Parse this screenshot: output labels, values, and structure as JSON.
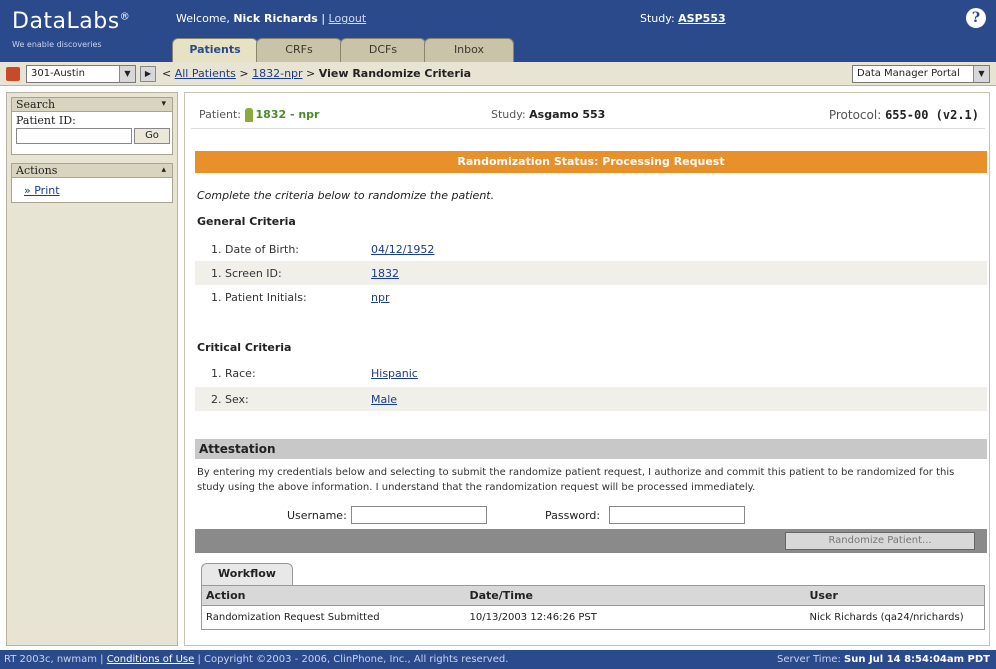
{
  "header": {
    "logo": "DataLabs",
    "logo_mark": "®",
    "tagline": "We enable discoveries",
    "welcome_prefix": "Welcome,",
    "user": "Nick Richards",
    "logout": "Logout",
    "study_label": "Study:",
    "study_value": "ASP553",
    "help": "?"
  },
  "tabs": [
    {
      "label": "Patients"
    },
    {
      "label": "CRFs"
    },
    {
      "label": "DCFs"
    },
    {
      "label": "Inbox"
    }
  ],
  "toolbar": {
    "site": "301-Austin",
    "bc_all": "All Patients",
    "bc_patient": "1832-npr",
    "bc_current": "View Randomize Criteria",
    "portal": "Data Manager Portal"
  },
  "sidebar": {
    "search_title": "Search",
    "patient_id_label": "Patient ID:",
    "go": "Go",
    "actions_title": "Actions",
    "print": "Print"
  },
  "patient_bar": {
    "patient_label": "Patient:",
    "patient_value": "1832 - npr",
    "study_label": "Study:",
    "study_value": "Asgamo 553",
    "protocol_label": "Protocol:",
    "protocol_value": "655-00 (v2.1)"
  },
  "status_banner": "Randomization Status: Processing Request",
  "instruction": "Complete the criteria below to randomize the patient.",
  "general": {
    "title": "General Criteria",
    "rows": [
      {
        "label": "1. Date of Birth:",
        "value": "04/12/1952"
      },
      {
        "label": "1. Screen ID:",
        "value": "1832"
      },
      {
        "label": "1. Patient Initials:",
        "value": "npr"
      }
    ]
  },
  "critical": {
    "title": "Critical Criteria",
    "rows": [
      {
        "label": "1. Race:",
        "value": "Hispanic"
      },
      {
        "label": "2. Sex:",
        "value": "Male"
      }
    ]
  },
  "attestation": {
    "title": "Attestation",
    "text": "By entering my credentials below and selecting to submit the randomize patient request, I authorize and commit this patient to be randomized for this study using the above information. I understand that the randomization request will be processed immediately.",
    "username_label": "Username:",
    "password_label": "Password:",
    "submit": "Randomize Patient..."
  },
  "workflow": {
    "tab": "Workflow",
    "columns": [
      "Action",
      "Date/Time",
      "User"
    ],
    "rows": [
      [
        "Randomization Request Submitted",
        "10/13/2003 12:46:26 PST",
        "Nick Richards (qa24/nrichards)"
      ]
    ]
  },
  "footer": {
    "left": "RT 2003c, nwmam |",
    "conditions": "Conditions of Use",
    "copyright": "| Copyright ©2003 - 2006, ClinPhone, Inc., All rights reserved.",
    "server_label": "Server Time:",
    "server_value": "Sun Jul 14 8:54:04am PDT"
  }
}
